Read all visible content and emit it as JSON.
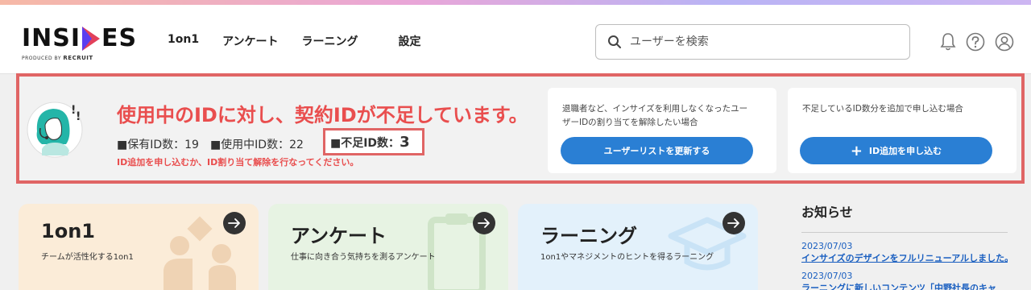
{
  "header": {
    "logo": {
      "brand": "INSIDES",
      "brand_left": "INSI",
      "brand_right": "ES",
      "produced_by": "PRODUCED BY",
      "company": "RECRUIT"
    },
    "nav": [
      {
        "label": "1on1"
      },
      {
        "label": "アンケート"
      },
      {
        "label": "ラーニング"
      },
      {
        "label": "設定"
      }
    ],
    "search": {
      "placeholder": "ユーザーを検索",
      "value": ""
    },
    "icons": [
      "bell-icon",
      "help-icon",
      "account-icon"
    ]
  },
  "alert": {
    "title": "使用中のIDに対し、契約IDが不足しています。",
    "owned": "■保有ID数：19",
    "in_use": "■使用中ID数：22",
    "shortage_label": "■不足ID数：",
    "shortage_value": "3",
    "hint": "ID追加を申し込むか、ID割り当て解除を行なってください。",
    "card_release": {
      "text": "退職者など、インサイズを利用しなくなったユーザーのIDの割り当てを解除したい場合",
      "line1": "退職者など、インサイズを利用しなくなったユー",
      "line2": "ザーIDの割り当てを解除したい場合",
      "button": "ユーザーリストを更新する"
    },
    "card_add": {
      "text": "不足しているID数分を追加で申し込む場合",
      "button_icon": "+",
      "button": "ID追加を申し込む"
    },
    "colors": {
      "accent_red": "#e94e4e",
      "button_blue": "#2a7fd4"
    }
  },
  "tiles": [
    {
      "title": "1on1",
      "desc": "チームが活性化する1on1",
      "bg": "#fbecd8"
    },
    {
      "title": "アンケート",
      "desc": "仕事に向き合う気持ちを測るアンケート",
      "bg": "#e7f3e3"
    },
    {
      "title": "ラーニング",
      "desc": "1on1やマネジメントのヒントを得るラーニング",
      "bg": "#e3f1fb"
    }
  ],
  "news": {
    "title": "お知らせ",
    "items": [
      {
        "date": "2023/07/03",
        "text": "インサイズのデザインをフルリニューアルしました。"
      },
      {
        "date": "2023/07/03",
        "text": "ラーニングに新しいコンテンツ「中野社長のキャ"
      }
    ]
  }
}
